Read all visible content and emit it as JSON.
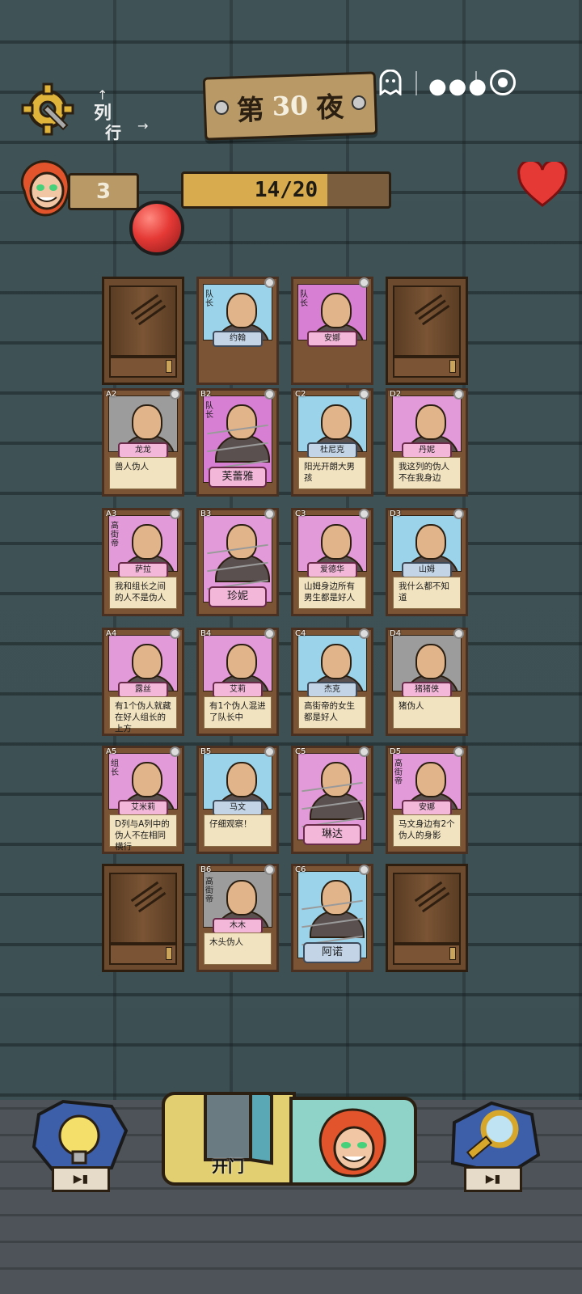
{
  "header": {
    "night_prefix": "第",
    "night_number": "30",
    "night_suffix": "夜",
    "col_label": "列",
    "row_label": "行"
  },
  "status": {
    "lives": "3",
    "progress_text": "14/20",
    "progress_fraction": 0.7
  },
  "colors": {
    "wall": "#3f5357",
    "plank": "#b99a66",
    "progress_fill": "#d8ac4e",
    "heart": "#e53935"
  },
  "grid": {
    "row1": [
      {
        "type": "door"
      },
      {
        "type": "caged",
        "role": "队长",
        "name": "约翰",
        "bg": "blue"
      },
      {
        "type": "caged",
        "role": "队长",
        "name": "安娜",
        "bg": "pink"
      },
      {
        "type": "door"
      }
    ],
    "cards": [
      {
        "pos": "A2",
        "name": "龙龙",
        "note": "兽人伪人",
        "bg": "gray"
      },
      {
        "pos": "B2",
        "role": "队长",
        "name": "芙蕾雅",
        "bg": "pink",
        "caged": true
      },
      {
        "pos": "C2",
        "name": "杜尼克",
        "note": "阳光开朗大男孩",
        "bg": "blue"
      },
      {
        "pos": "D2",
        "name": "丹妮",
        "note": "我这列的伪人不在我身边",
        "bg": "lpink"
      },
      {
        "pos": "A3",
        "role": "高街帝",
        "name": "萨拉",
        "note": "我和组长之间的人不是伪人",
        "bg": "lpink"
      },
      {
        "pos": "B3",
        "name": "珍妮",
        "bg": "lpink",
        "caged": true
      },
      {
        "pos": "C3",
        "name": "爱德华",
        "note": "山姆身边所有男生都是好人",
        "bg": "lpink"
      },
      {
        "pos": "D3",
        "name": "山姆",
        "note": "我什么都不知道",
        "bg": "blue"
      },
      {
        "pos": "A4",
        "name": "露丝",
        "note": "有1个伪人就藏在好人组长的上方",
        "bg": "lpink"
      },
      {
        "pos": "B4",
        "name": "艾莉",
        "note": "有1个伪人混进了队长中",
        "bg": "lpink"
      },
      {
        "pos": "C4",
        "name": "杰克",
        "note": "高街帝的女生都是好人",
        "bg": "blue"
      },
      {
        "pos": "D4",
        "name": "猪猪侠",
        "note": "猪伪人",
        "bg": "gray"
      },
      {
        "pos": "A5",
        "role": "组长",
        "name": "艾米莉",
        "note": "D列与A列中的伪人不在相同横行",
        "bg": "lpink"
      },
      {
        "pos": "B5",
        "name": "马文",
        "note": "仔细观察！",
        "bg": "blue"
      },
      {
        "pos": "C5",
        "name": "琳达",
        "bg": "lpink",
        "caged": true
      },
      {
        "pos": "D5",
        "role": "高街帝",
        "name": "安娜",
        "note": "马文身边有2个伪人的身影",
        "bg": "lpink"
      }
    ],
    "row6": [
      {
        "type": "door"
      },
      {
        "pos": "B6",
        "role": "高街帝",
        "name": "木木",
        "note": "木头伪人",
        "bg": "gray"
      },
      {
        "pos": "C6",
        "name": "阿诺",
        "bg": "blue",
        "caged": true
      },
      {
        "type": "door"
      }
    ]
  },
  "bottom": {
    "open_door_label": "开门",
    "video_icon": "video-icon"
  }
}
